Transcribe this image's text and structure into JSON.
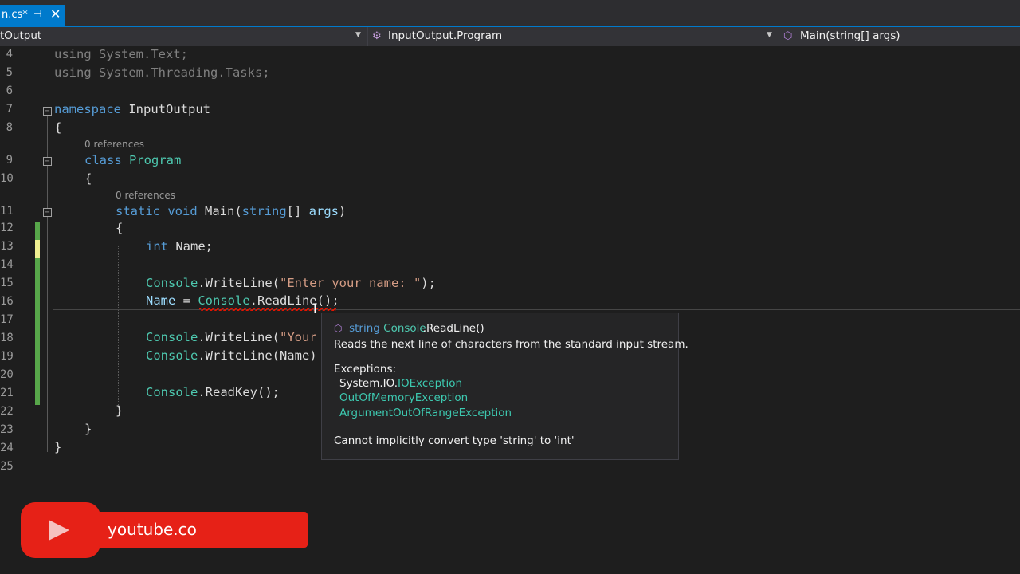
{
  "tab": {
    "name": "n.cs*",
    "pin_icon": "pin-icon",
    "close_icon": "close-icon"
  },
  "navbar": {
    "project": "tOutput",
    "class_scope": "InputOutput.Program",
    "member_scope": "Main(string[] args)"
  },
  "editor": {
    "line_numbers": [
      "4",
      "5",
      "6",
      "7",
      "8",
      "9",
      "10",
      "11",
      "12",
      "13",
      "14",
      "15",
      "16",
      "17",
      "18",
      "19",
      "20",
      "21",
      "22",
      "23",
      "24",
      "25"
    ],
    "codelens_class": "0 references",
    "codelens_method": "0 references",
    "lines": {
      "l4_kw": "using",
      "l4_rest": " System.Text;",
      "l5_kw": "using",
      "l5_rest": " System.Threading.Tasks;",
      "l7_kw": "namespace",
      "l7_name": " InputOutput",
      "l8": "{",
      "l9_kw": "class",
      "l9_name": "Program",
      "l10": "{",
      "l11_kw1": "static",
      "l11_kw2": "void",
      "l11_name": " Main(",
      "l11_kw3": "string",
      "l11_mid": "[] ",
      "l11_arg": "args",
      "l11_end": ")",
      "l12": "{",
      "l13_kw": "int",
      "l13_rest": " Name;",
      "l15_cls": "Console",
      "l15_mid": ".WriteLine(",
      "l15_str": "\"Enter your name: \"",
      "l15_end": ");",
      "l16_var": "Name",
      "l16_eq": " = ",
      "l16_cls": "Console",
      "l16_mid": ".ReadLine",
      "l16_end": "();",
      "l18_cls": "Console",
      "l18_mid": ".WriteLine(",
      "l18_str": "\"Your",
      "l19_cls": "Console",
      "l19_mid": ".WriteLine(Name)",
      "l21_cls": "Console",
      "l21_mid": ".ReadKey();",
      "l22": "}",
      "l23": "}",
      "l24": "}"
    }
  },
  "tooltip": {
    "icon": "method-icon",
    "sig_type": "string",
    "sig_class": "Console",
    "sig_method": ".ReadLine()",
    "description": "Reads the next line of characters from the standard input stream.",
    "exceptions_label": "Exceptions:",
    "exc1_ns": "System.IO.",
    "exc1_name": "IOException",
    "exc2": "OutOfMemoryException",
    "exc3": "ArgumentOutOfRangeException",
    "error": "Cannot implicitly convert type 'string' to 'int'"
  },
  "watermark": {
    "text": "youtube.co",
    "icon": "youtube-play-icon"
  },
  "colors": {
    "accent": "#007acc",
    "keyword": "#569cd6",
    "type": "#4ec9b0",
    "string": "#d69d85",
    "error": "#e51400",
    "youtube": "#e62117"
  }
}
